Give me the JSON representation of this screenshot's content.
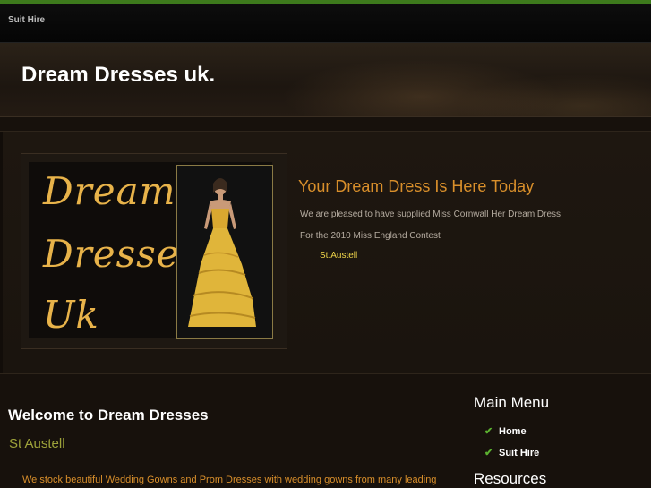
{
  "topnav": {
    "items": [
      {
        "label": "Suit Hire"
      }
    ]
  },
  "header": {
    "title": "Dream Dresses uk."
  },
  "feature": {
    "logo_lines": [
      "Dream",
      "Dresses",
      "Uk"
    ],
    "headline": "Your Dream Dress Is Here Today",
    "lines": [
      "We are pleased to have supplied Miss Cornwall Her Dream Dress",
      "For the 2010 Miss England Contest"
    ],
    "link_text": "St.Austell"
  },
  "main": {
    "title": "Welcome to Dream Dresses",
    "subtitle": "St Austell",
    "intro": "We stock beautiful Wedding Gowns and Prom Dresses with wedding gowns from many leading"
  },
  "sidebar": {
    "menu_heading": "Main Menu",
    "menu_items": [
      {
        "label": "Home"
      },
      {
        "label": "Suit Hire"
      }
    ],
    "resources_heading": "Resources"
  },
  "colors": {
    "accent": "#d98f2b",
    "green_bar": "#3d7a1c",
    "link": "#f0d64a",
    "gold_logo": "#e8b34a"
  }
}
